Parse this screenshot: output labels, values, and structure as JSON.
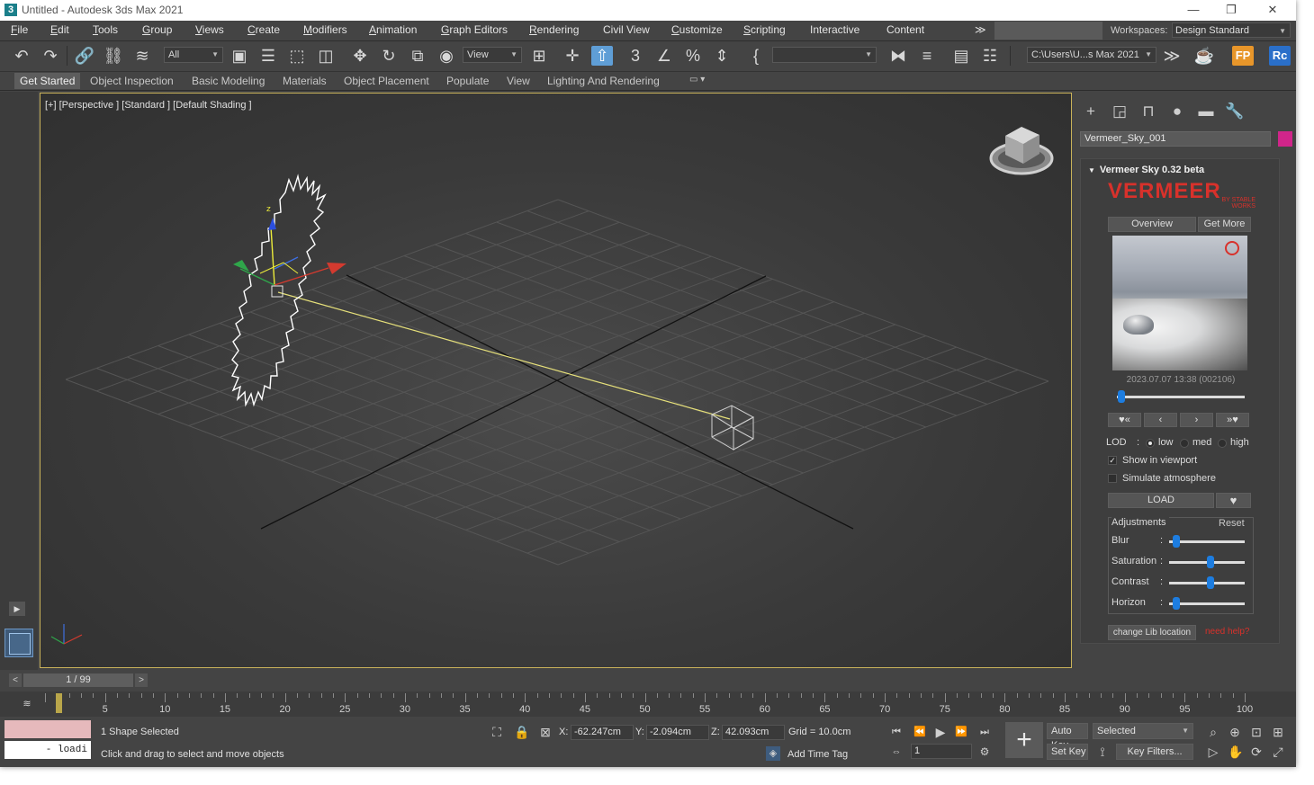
{
  "window": {
    "title": "Untitled - Autodesk 3ds Max 2021",
    "app_icon": "3",
    "controls": [
      "—",
      "❐",
      "✕"
    ]
  },
  "menu": {
    "items": [
      {
        "label": "File",
        "u": "F",
        "rest": "ile"
      },
      {
        "label": "Edit",
        "u": "E",
        "rest": "dit"
      },
      {
        "label": "Tools",
        "u": "T",
        "rest": "ools"
      },
      {
        "label": "Group",
        "u": "G",
        "rest": "roup"
      },
      {
        "label": "Views",
        "u": "V",
        "rest": "iews"
      },
      {
        "label": "Create",
        "u": "C",
        "rest": "reate"
      },
      {
        "label": "Modifiers",
        "u": "M",
        "rest": "odifiers"
      },
      {
        "label": "Animation",
        "u": "A",
        "rest": "nimation"
      },
      {
        "label": "Graph Editors",
        "u": "G",
        "rest": "raph Editors"
      },
      {
        "label": "Rendering",
        "u": "R",
        "rest": "endering"
      },
      {
        "label": "Civil View",
        "u": "",
        "rest": "Civil View"
      },
      {
        "label": "Customize",
        "u": "C",
        "rest": "ustomize"
      },
      {
        "label": "Scripting",
        "u": "S",
        "rest": "cripting"
      },
      {
        "label": "Interactive",
        "u": "",
        "rest": "Interactive"
      },
      {
        "label": "Content",
        "u": "",
        "rest": "Content"
      }
    ],
    "overflow": "≫",
    "workspaces_label": "Workspaces:",
    "workspace": "Design Standard"
  },
  "toolbar": {
    "selection_filter": "All",
    "ref_coord": "View",
    "named_selection": "",
    "project_path": "C:\\Users\\U...s Max 2021",
    "overflow": "≫",
    "fp_label": "FP",
    "rc_label": "Rc"
  },
  "ribbon": {
    "tabs": [
      "Get Started",
      "Object Inspection",
      "Basic Modeling",
      "Materials",
      "Object Placement",
      "Populate",
      "View",
      "Lighting And Rendering"
    ]
  },
  "viewport": {
    "label": "[+] [Perspective ] [Standard ] [Default Shading ]",
    "axis_z": "z"
  },
  "command_panel": {
    "object_name": "Vermeer_Sky_001",
    "object_color": "#d0258a",
    "rollout_title": "Vermeer Sky 0.32 beta",
    "logo": "VERMEER",
    "logo_sub": "BY STABLE WORKS",
    "overview_btn": "Overview",
    "get_more_btn": "Get More",
    "preview_date": "2023.07.07 13:38 (002106)",
    "preview_position": 0.02,
    "nav": [
      "♥«",
      "‹",
      "›",
      "»♥"
    ],
    "lod_label": "LOD",
    "lod_colon": ":",
    "lod_options": [
      "low",
      "med",
      "high"
    ],
    "lod_selected": "low",
    "show_in_viewport_label": "Show in viewport",
    "show_in_viewport": true,
    "simulate_atmosphere_label": "Simulate atmosphere",
    "simulate_atmosphere": false,
    "load_btn": "LOAD",
    "fav_btn": "♥",
    "adjustments_label": "Adjustments",
    "reset_label": "Reset",
    "adjustments": [
      {
        "label": "Blur",
        "value": 0.05
      },
      {
        "label": "Saturation",
        "value": 0.5
      },
      {
        "label": "Contrast",
        "value": 0.5
      },
      {
        "label": "Horizon",
        "value": 0.05
      }
    ],
    "change_lib_btn": "change Lib location",
    "need_help": "need help?"
  },
  "timeline": {
    "frame_display": "1 / 99",
    "ticks": [
      "5",
      "10",
      "15",
      "20",
      "25",
      "30",
      "35",
      "40",
      "45",
      "50",
      "55",
      "60",
      "65",
      "70",
      "75",
      "80",
      "85",
      "90",
      "95",
      "100"
    ],
    "current_frame": 1,
    "max_frame": 100
  },
  "status": {
    "maxscript_text": "- loadi",
    "selection": "1 Shape Selected",
    "prompt": "Click and drag to select and move objects",
    "x_label": "X:",
    "x_value": "-62.247cm",
    "y_label": "Y:",
    "y_value": "-2.094cm",
    "z_label": "Z:",
    "z_value": "42.093cm",
    "grid": "Grid = 10.0cm",
    "add_time_tag": "Add Time Tag",
    "auto_key": "Auto Key",
    "set_key": "Set Key",
    "selected_dropdown": "Selected",
    "key_filters": "Key Filters...",
    "frame_field": "1"
  }
}
